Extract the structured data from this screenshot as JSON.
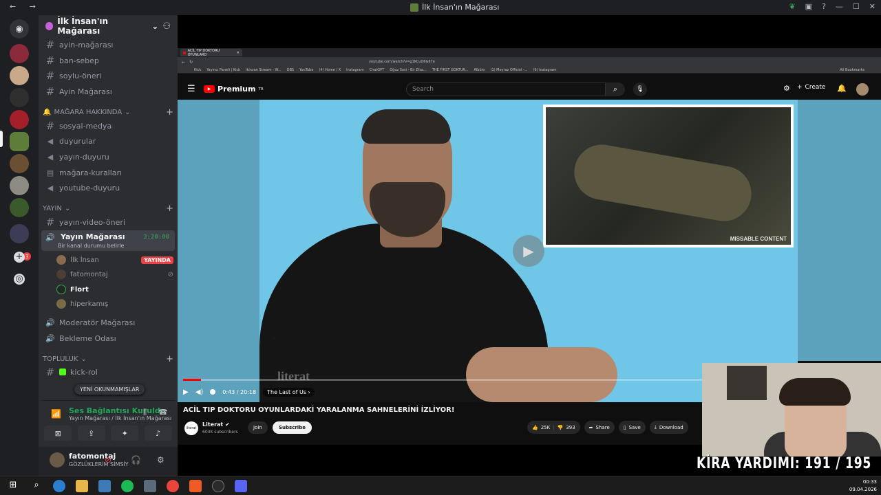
{
  "window": {
    "title": "İlk İnsan'ın Mağarası",
    "nav": "← →"
  },
  "server": {
    "name": "İlk İnsan'ın Mağarası"
  },
  "channels_top": [
    {
      "label": "ayin-mağarası"
    },
    {
      "label": "ban-sebep"
    },
    {
      "label": "soylu-öneri"
    },
    {
      "label": "Ayin Mağarası"
    }
  ],
  "category_1": {
    "label": "MAĞARA HAKKINDA"
  },
  "channels_cat1": [
    {
      "label": "sosyal-medya"
    },
    {
      "label": "duyurular"
    },
    {
      "label": "yayın-duyuru"
    },
    {
      "label": "mağara-kuralları"
    },
    {
      "label": "youtube-duyuru"
    }
  ],
  "category_2": {
    "label": "YAYIN"
  },
  "channels_cat2": [
    {
      "label": "yayın-video-öneri"
    }
  ],
  "voice_active": {
    "name": "Yayın Mağarası",
    "status": "Bir kanal durumu belirle",
    "time": "3:20:00"
  },
  "voice_users": [
    {
      "name": "İlk İnsan",
      "badge": "YAYINDA"
    },
    {
      "name": "fatomontaj"
    },
    {
      "name": "Flort"
    },
    {
      "name": "hiperkamış"
    }
  ],
  "channels_voice_other": [
    {
      "label": "Moderatör Mağarası"
    },
    {
      "label": "Bekleme Odası"
    }
  ],
  "category_3": {
    "label": "TOPLULUK"
  },
  "channels_cat3": [
    {
      "label": "kick-rol"
    }
  ],
  "unread_pill": "YENİ OKUNMAMIŞLAR",
  "voice_connection": {
    "title": "Ses Bağlantısı Kuruldu",
    "subtitle": "Yayın Mağarası / İlk İnsan'ın Mağarası"
  },
  "user_panel": {
    "name": "fatomontaj",
    "status": "GÖZLÜKLERİM SİMSİY"
  },
  "browser": {
    "tab_title": "ACİL TIP DOKTORU OYUNLARD",
    "url": "youtube.com/watch?v=g1KCuD6&67e",
    "bookmarks": [
      "Kick",
      "Yayıncı Paneli | Kick",
      "Ikinzan Stream - W...",
      "OBS",
      "YouTube",
      "(4) Home / X",
      "Instagram",
      "ChatGPT",
      "Oğuz Sasi - Bir Efsa...",
      "THE FIRST GOKTUR...",
      "Albüm",
      "(1) Meyraz Official -...",
      "(9) Instagram"
    ],
    "all_bookmarks": "All Bookmarks"
  },
  "youtube": {
    "logo": "Premium",
    "logo_sup": "TR",
    "search_placeholder": "Search",
    "create": "Create"
  },
  "video": {
    "inset_label": "MISSABLE CONTENT",
    "watermark": "literat",
    "time": "0:43 / 20:18",
    "chapter": "The Last of Us",
    "progress_fraction": 0.035,
    "title": "ACİL TIP DOKTORU OYUNLARDAKİ YARALANMA SAHNELERİNİ İZLİYOR!",
    "channel": "Literat",
    "subscribers": "603K subscribers",
    "join": "Join",
    "subscribe": "Subscribe",
    "likes": "25K",
    "dislikes": "393",
    "share": "Share",
    "save": "Save",
    "download": "Download",
    "channel_logo_text": "literat"
  },
  "overlay": {
    "kira": "KİRA YARDIMI:  191 / 195"
  },
  "taskbar": {
    "time": "00:33",
    "date": "09.04.2026"
  },
  "colors": {
    "discord_bg": "#2b2d31",
    "accent_green": "#23a55a",
    "live_red": "#ed4245",
    "yt_red": "#ff0000",
    "video_bg": "#6fc6e7"
  }
}
